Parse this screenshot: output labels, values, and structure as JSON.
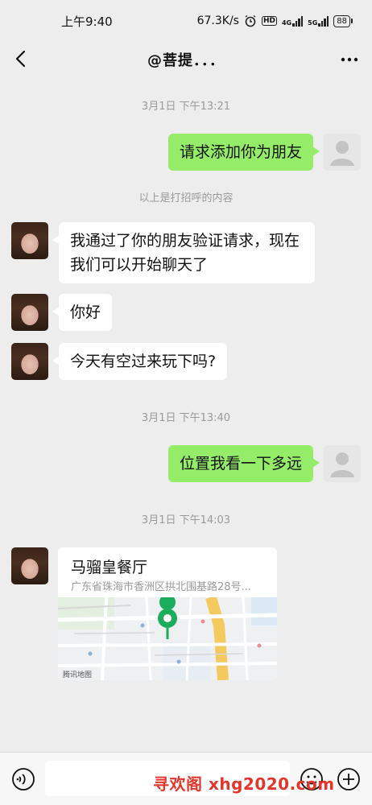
{
  "status": {
    "time": "上午9:40",
    "speed": "67.3K/s",
    "battery": "88",
    "hd": "HD",
    "net1": "4G",
    "net2": "5G"
  },
  "header": {
    "title": "@菩提．．．"
  },
  "chat": {
    "time1": "3月1日 下午13:21",
    "msg_out_1": "请求添加你为朋友",
    "greeting_hint": "以上是打招呼的内容",
    "msg_in_1_line1": "我通过了你的朋友验证请求，现在",
    "msg_in_1_line2": "我们可以开始聊天了",
    "msg_in_2": "你好",
    "msg_in_3": "今天有空过来玩下吗?",
    "time2": "3月1日 下午13:40",
    "msg_out_2": "位置我看一下多远",
    "time3": "3月1日 下午14:03",
    "location": {
      "name": "马骝皇餐厅",
      "address": "广东省珠海市香洲区拱北围基路28号...",
      "map_brand": "腾讯地图"
    }
  },
  "watermark": "寻欢阁 xhg2020.com",
  "colors": {
    "background": "#ededed",
    "outgoing_bubble": "#95ec69",
    "incoming_bubble": "#ffffff",
    "pin": "#1aad5b",
    "watermark": "#e3352b"
  }
}
